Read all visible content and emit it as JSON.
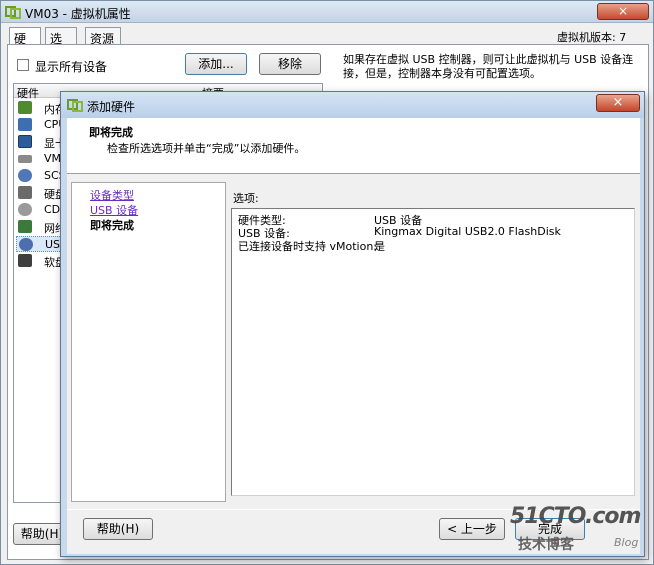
{
  "background_window": {
    "title": "VM03 - 虚拟机属性",
    "close_label": "×",
    "tabs": [
      {
        "label": "硬件"
      },
      {
        "label": "选项"
      },
      {
        "label": "资源"
      }
    ],
    "version": "虚拟机版本: 7",
    "show_all_label": "显示所有设备",
    "add_label": "添加...",
    "remove_label": "移除",
    "description": "如果存在虚拟 USB 控制器，则可让此虚拟机与 USB 设备连接，但是，控制器本身没有可配置选项。",
    "columns": {
      "hardware": "硬件",
      "summary": "摘要"
    },
    "hardware_items": [
      {
        "label": "内存",
        "icon": "memory-icon"
      },
      {
        "label": "CPU",
        "icon": "cpu-icon"
      },
      {
        "label": "显卡",
        "icon": "display-icon"
      },
      {
        "label": "VMC",
        "icon": "vmci-icon"
      },
      {
        "label": "SCS",
        "icon": "scsi-icon"
      },
      {
        "label": "硬盘",
        "icon": "harddisk-icon"
      },
      {
        "label": "CD/",
        "icon": "cdrom-icon"
      },
      {
        "label": "网络",
        "icon": "network-icon"
      },
      {
        "label": "USB",
        "icon": "usb-icon"
      },
      {
        "label": "软盘",
        "icon": "floppy-icon"
      }
    ],
    "help_label": "帮助(H)"
  },
  "dialog": {
    "title": "添加硬件",
    "close_label": "×",
    "header_title": "即将完成",
    "header_subtitle": "检查所选选项并单击“完成”以添加硬件。",
    "steps": [
      {
        "label": "设备类型",
        "state": "link"
      },
      {
        "label": "USB 设备",
        "state": "link"
      },
      {
        "label": "即将完成",
        "state": "current"
      }
    ],
    "options_label": "选项:",
    "options": [
      {
        "key": "硬件类型:",
        "value": "USB 设备"
      },
      {
        "key": "USB 设备:",
        "value": "Kingmax Digital USB2.0 FlashDisk"
      },
      {
        "key": "已连接设备时支持 vMotion:",
        "value": "是"
      }
    ],
    "help_label": "帮助(H)",
    "back_label": "< 上一步",
    "finish_label": "完成"
  },
  "watermark": {
    "main": "51CTO.com",
    "sub": "技术博客",
    "blog": "Blog"
  },
  "colors": {
    "link": "#6a2cc2",
    "titlebar": "#c3d3e6",
    "selection": "#dbe8f8"
  }
}
